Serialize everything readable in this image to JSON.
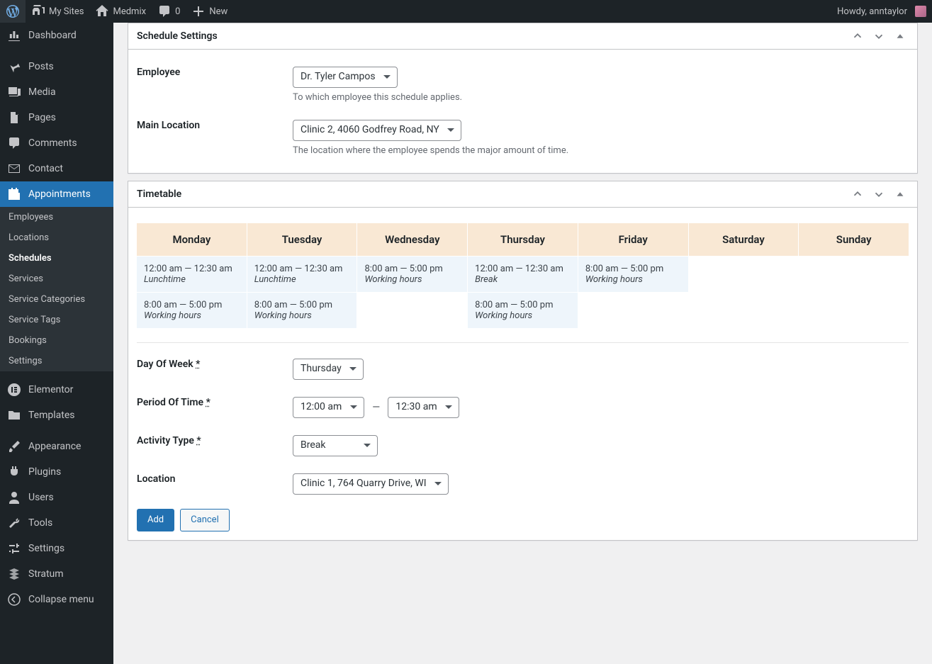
{
  "adminbar": {
    "wp_logo": "WordPress",
    "mysites": "My Sites",
    "site": "Medmix",
    "comments_count": "0",
    "new_label": "New",
    "howdy": "Howdy, anntaylor"
  },
  "sidebar": {
    "dashboard": "Dashboard",
    "posts": "Posts",
    "media": "Media",
    "pages": "Pages",
    "comments": "Comments",
    "contact": "Contact",
    "appointments": "Appointments",
    "sub": {
      "employees": "Employees",
      "locations": "Locations",
      "schedules": "Schedules",
      "services": "Services",
      "service_categories": "Service Categories",
      "service_tags": "Service Tags",
      "bookings": "Bookings",
      "settings": "Settings"
    },
    "elementor": "Elementor",
    "templates": "Templates",
    "appearance": "Appearance",
    "plugins": "Plugins",
    "users": "Users",
    "tools": "Tools",
    "settings": "Settings",
    "stratum": "Stratum",
    "collapse": "Collapse menu"
  },
  "panels": {
    "schedule": {
      "title": "Schedule Settings",
      "employee_label": "Employee",
      "employee_value": "Dr. Tyler Campos",
      "employee_desc": "To which employee this schedule applies.",
      "location_label": "Main Location",
      "location_value": "Clinic 2, 4060 Godfrey Road, NY",
      "location_desc": "The location where the employee spends the major amount of time."
    },
    "timetable": {
      "title": "Timetable",
      "days": [
        "Monday",
        "Tuesday",
        "Wednesday",
        "Thursday",
        "Friday",
        "Saturday",
        "Sunday"
      ],
      "slots": {
        "mon": [
          {
            "time": "12:00 am — 12:30 am",
            "label": "Lunchtime"
          },
          {
            "time": "8:00 am — 5:00 pm",
            "label": "Working hours"
          }
        ],
        "tue": [
          {
            "time": "12:00 am — 12:30 am",
            "label": "Lunchtime"
          },
          {
            "time": "8:00 am — 5:00 pm",
            "label": "Working hours"
          }
        ],
        "wed": [
          {
            "time": "8:00 am — 5:00 pm",
            "label": "Working hours"
          }
        ],
        "thu": [
          {
            "time": "12:00 am — 12:30 am",
            "label": "Break"
          },
          {
            "time": "8:00 am — 5:00 pm",
            "label": "Working hours"
          }
        ],
        "fri": [
          {
            "time": "8:00 am — 5:00 pm",
            "label": "Working hours"
          }
        ],
        "sat": [],
        "sun": []
      },
      "form": {
        "dow_label": "Day Of Week",
        "dow_value": "Thursday",
        "period_label": "Period Of Time",
        "period_from": "12:00 am",
        "period_to": "12:30 am",
        "period_sep": "—",
        "activity_label": "Activity Type",
        "activity_value": "Break",
        "location_label": "Location",
        "location_value": "Clinic 1, 764 Quarry Drive, WI",
        "required_marker": "*",
        "add_btn": "Add",
        "cancel_btn": "Cancel"
      }
    }
  }
}
